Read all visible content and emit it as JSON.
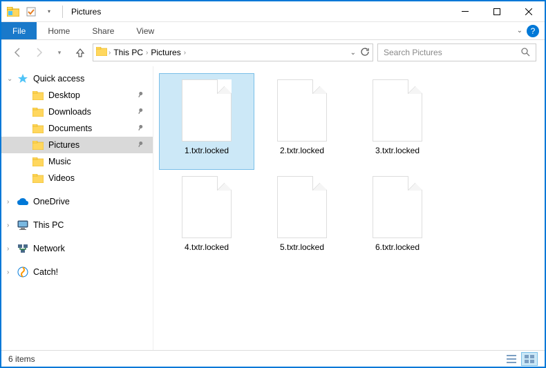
{
  "window": {
    "title": "Pictures"
  },
  "ribbon": {
    "file": "File",
    "tabs": [
      "Home",
      "Share",
      "View"
    ]
  },
  "breadcrumb": {
    "items": [
      "This PC",
      "Pictures"
    ]
  },
  "search": {
    "placeholder": "Search Pictures"
  },
  "sidebar": {
    "quick_access": {
      "label": "Quick access",
      "items": [
        {
          "label": "Desktop",
          "pinned": true
        },
        {
          "label": "Downloads",
          "pinned": true
        },
        {
          "label": "Documents",
          "pinned": true
        },
        {
          "label": "Pictures",
          "pinned": true,
          "selected": true
        },
        {
          "label": "Music",
          "pinned": false
        },
        {
          "label": "Videos",
          "pinned": false
        }
      ]
    },
    "roots": [
      {
        "label": "OneDrive",
        "icon": "onedrive"
      },
      {
        "label": "This PC",
        "icon": "pc"
      },
      {
        "label": "Network",
        "icon": "network"
      },
      {
        "label": "Catch!",
        "icon": "catch"
      }
    ]
  },
  "files": [
    {
      "name": "1.txtr.locked",
      "selected": true
    },
    {
      "name": "2.txtr.locked"
    },
    {
      "name": "3.txtr.locked"
    },
    {
      "name": "4.txtr.locked"
    },
    {
      "name": "5.txtr.locked"
    },
    {
      "name": "6.txtr.locked"
    }
  ],
  "statusbar": {
    "count_text": "6 items"
  },
  "colors": {
    "accent": "#0078d7",
    "selection": "#cce8f7"
  }
}
